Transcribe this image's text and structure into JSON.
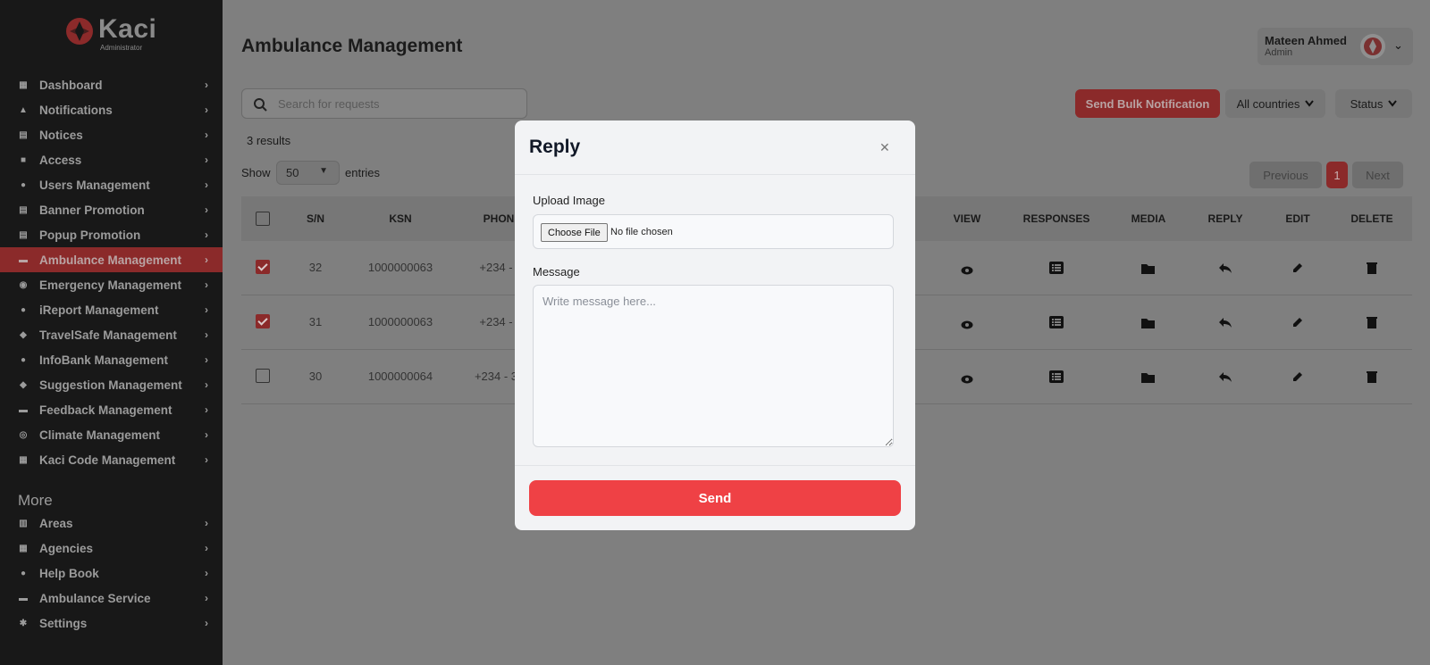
{
  "brand": {
    "name": "Kaci",
    "subtitle": "Administrator"
  },
  "sidebar": {
    "items": [
      {
        "label": "Dashboard",
        "icon": "dashboard-icon"
      },
      {
        "label": "Notifications",
        "icon": "bell-icon"
      },
      {
        "label": "Notices",
        "icon": "notice-icon"
      },
      {
        "label": "Access",
        "icon": "lock-icon"
      },
      {
        "label": "Users Management",
        "icon": "user-icon"
      },
      {
        "label": "Banner Promotion",
        "icon": "banner-icon"
      },
      {
        "label": "Popup Promotion",
        "icon": "popup-icon"
      },
      {
        "label": "Ambulance Management",
        "icon": "ambulance-icon",
        "active": true
      },
      {
        "label": "Emergency Management",
        "icon": "emergency-icon"
      },
      {
        "label": "iReport Management",
        "icon": "report-icon"
      },
      {
        "label": "TravelSafe Management",
        "icon": "travel-icon"
      },
      {
        "label": "InfoBank Management",
        "icon": "info-icon"
      },
      {
        "label": "Suggestion Management",
        "icon": "suggestion-icon"
      },
      {
        "label": "Feedback Management",
        "icon": "feedback-icon"
      },
      {
        "label": "Climate Management",
        "icon": "globe-icon"
      },
      {
        "label": "Kaci Code Management",
        "icon": "code-icon"
      }
    ],
    "more_title": "More",
    "more_items": [
      {
        "label": "Areas",
        "icon": "map-icon"
      },
      {
        "label": "Agencies",
        "icon": "building-icon"
      },
      {
        "label": "Help Book",
        "icon": "people-icon"
      },
      {
        "label": "Ambulance Service",
        "icon": "ambulance-icon"
      },
      {
        "label": "Settings",
        "icon": "gear-icon"
      }
    ]
  },
  "header": {
    "title": "Ambulance Management",
    "user_name": "Mateen Ahmed",
    "user_role": "Admin"
  },
  "toolbar": {
    "search_placeholder": "Search for requests",
    "bulk_label": "Send Bulk Notification",
    "countries_label": "All countries",
    "status_label": "Status"
  },
  "listing": {
    "results": "3 results",
    "show_label": "Show",
    "page_size": "50",
    "entries_label": "entries"
  },
  "pagination": {
    "prev": "Previous",
    "current": "1",
    "next": "Next"
  },
  "table": {
    "headers": [
      "S/N",
      "KSN",
      "PHON",
      "VIEW",
      "RESPONSES",
      "MEDIA",
      "REPLY",
      "EDIT",
      "DELETE"
    ],
    "rows": [
      {
        "sn": "32",
        "ksn": "1000000063",
        "phone": "+234 -",
        "checked": true
      },
      {
        "sn": "31",
        "ksn": "1000000063",
        "phone": "+234 -",
        "checked": true
      },
      {
        "sn": "30",
        "ksn": "1000000064",
        "phone": "+234 - 3",
        "checked": false
      }
    ]
  },
  "modal": {
    "title": "Reply",
    "upload_label": "Upload Image",
    "choose_file": "Choose File",
    "file_status": "No file chosen",
    "message_label": "Message",
    "message_placeholder": "Write message here...",
    "send_label": "Send"
  },
  "colors": {
    "accent": "#ef4145",
    "sidebar_bg": "#181818",
    "active_dim": "#8b2a2a"
  }
}
